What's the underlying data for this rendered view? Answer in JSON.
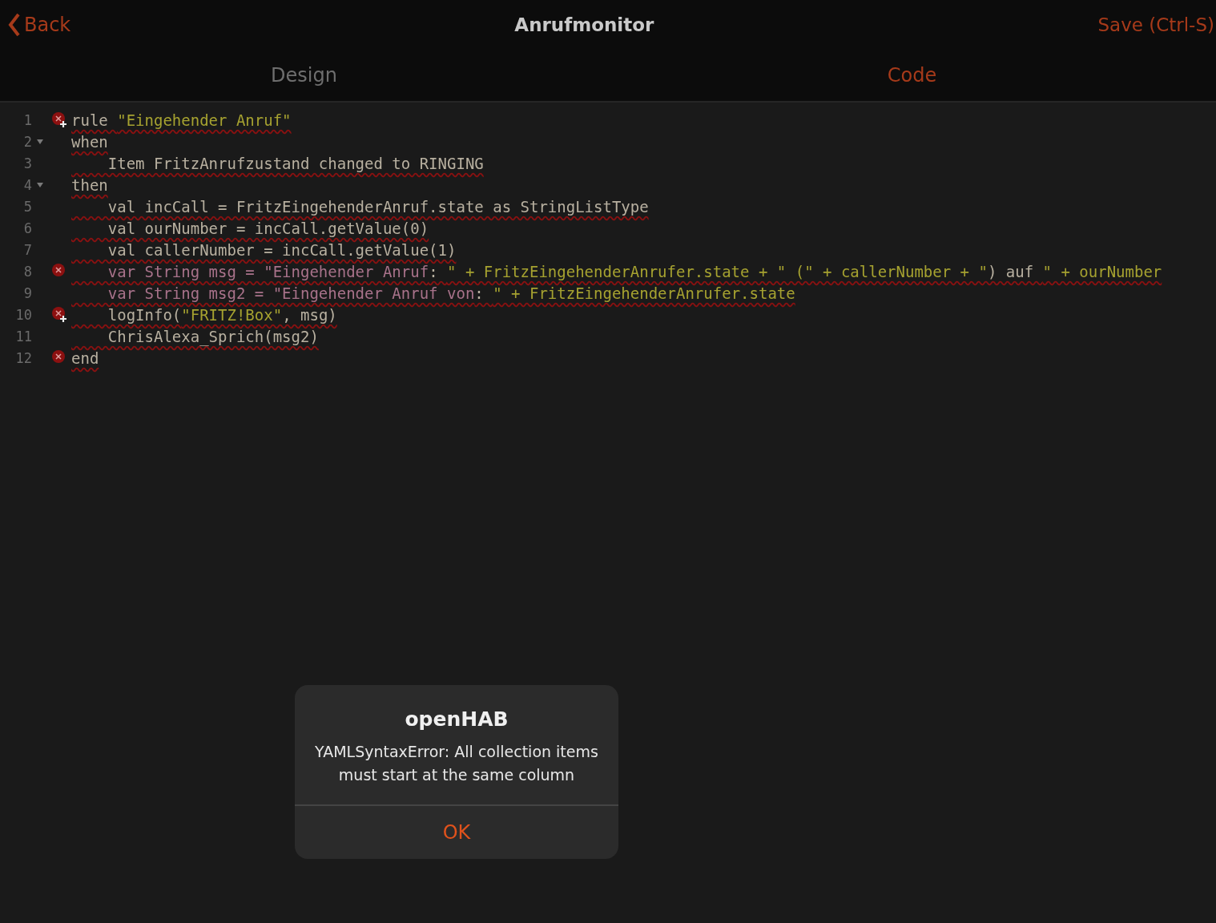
{
  "header": {
    "back": "Back",
    "title": "Anrufmonitor",
    "save": "Save (Ctrl-S)"
  },
  "tabs": [
    {
      "label": "Design",
      "selected": false
    },
    {
      "label": "Code",
      "selected": true
    }
  ],
  "editor": {
    "lines": [
      {
        "number": "1",
        "fold": false,
        "error": true,
        "quick_fix": true,
        "tokens": [
          {
            "kind": "plain",
            "text": "rule "
          },
          {
            "kind": "string",
            "text": "\"Eingehender Anruf\""
          }
        ]
      },
      {
        "number": "2",
        "fold": true,
        "error": false,
        "tokens": [
          {
            "kind": "plain",
            "text": "when"
          }
        ]
      },
      {
        "number": "3",
        "fold": false,
        "error": false,
        "tokens": [
          {
            "kind": "plain",
            "text": "    Item FritzAnrufzustand changed to RINGING"
          }
        ]
      },
      {
        "number": "4",
        "fold": true,
        "error": false,
        "tokens": [
          {
            "kind": "plain",
            "text": "then"
          }
        ]
      },
      {
        "number": "5",
        "fold": false,
        "error": false,
        "tokens": [
          {
            "kind": "plain",
            "text": "    val incCall = FritzEingehenderAnruf.state as StringListType"
          }
        ]
      },
      {
        "number": "6",
        "fold": false,
        "error": false,
        "tokens": [
          {
            "kind": "plain",
            "text": "    val ourNumber = incCall.getValue(0)"
          }
        ]
      },
      {
        "number": "7",
        "fold": false,
        "error": false,
        "tokens": [
          {
            "kind": "plain",
            "text": "    val callerNumber = incCall.getValue(1)"
          }
        ]
      },
      {
        "number": "8",
        "fold": false,
        "error": true,
        "quick_fix": false,
        "tokens": [
          {
            "kind": "invalid",
            "text": "    var String msg = \"Eingehender Anruf"
          },
          {
            "kind": "plain",
            "text": ": "
          },
          {
            "kind": "string",
            "text": "\" + FritzEingehenderAnrufer.state + \" (\" + callerNumber + \""
          },
          {
            "kind": "plain",
            "text": ") auf "
          },
          {
            "kind": "string",
            "text": "\" + ourNumber"
          }
        ]
      },
      {
        "number": "9",
        "fold": false,
        "error": false,
        "tokens": [
          {
            "kind": "invalid",
            "text": "    var String msg2 = \"Eingehender Anruf von"
          },
          {
            "kind": "plain",
            "text": ": "
          },
          {
            "kind": "string",
            "text": "\" + FritzEingehenderAnrufer.state"
          }
        ]
      },
      {
        "number": "10",
        "fold": false,
        "error": true,
        "quick_fix": true,
        "tokens": [
          {
            "kind": "plain",
            "text": "    logInfo("
          },
          {
            "kind": "string",
            "text": "\"FRITZ!Box\""
          },
          {
            "kind": "plain",
            "text": ", msg)"
          }
        ]
      },
      {
        "number": "11",
        "fold": false,
        "error": false,
        "tokens": [
          {
            "kind": "plain",
            "text": "    ChrisAlexa_Sprich(msg2)"
          }
        ]
      },
      {
        "number": "12",
        "fold": false,
        "error": true,
        "quick_fix": false,
        "tokens": [
          {
            "kind": "plain",
            "text": "end"
          }
        ]
      }
    ]
  },
  "dialog": {
    "title": "openHAB",
    "message": "YAMLSyntaxError: All collection items must start at the same column",
    "button": "OK"
  }
}
